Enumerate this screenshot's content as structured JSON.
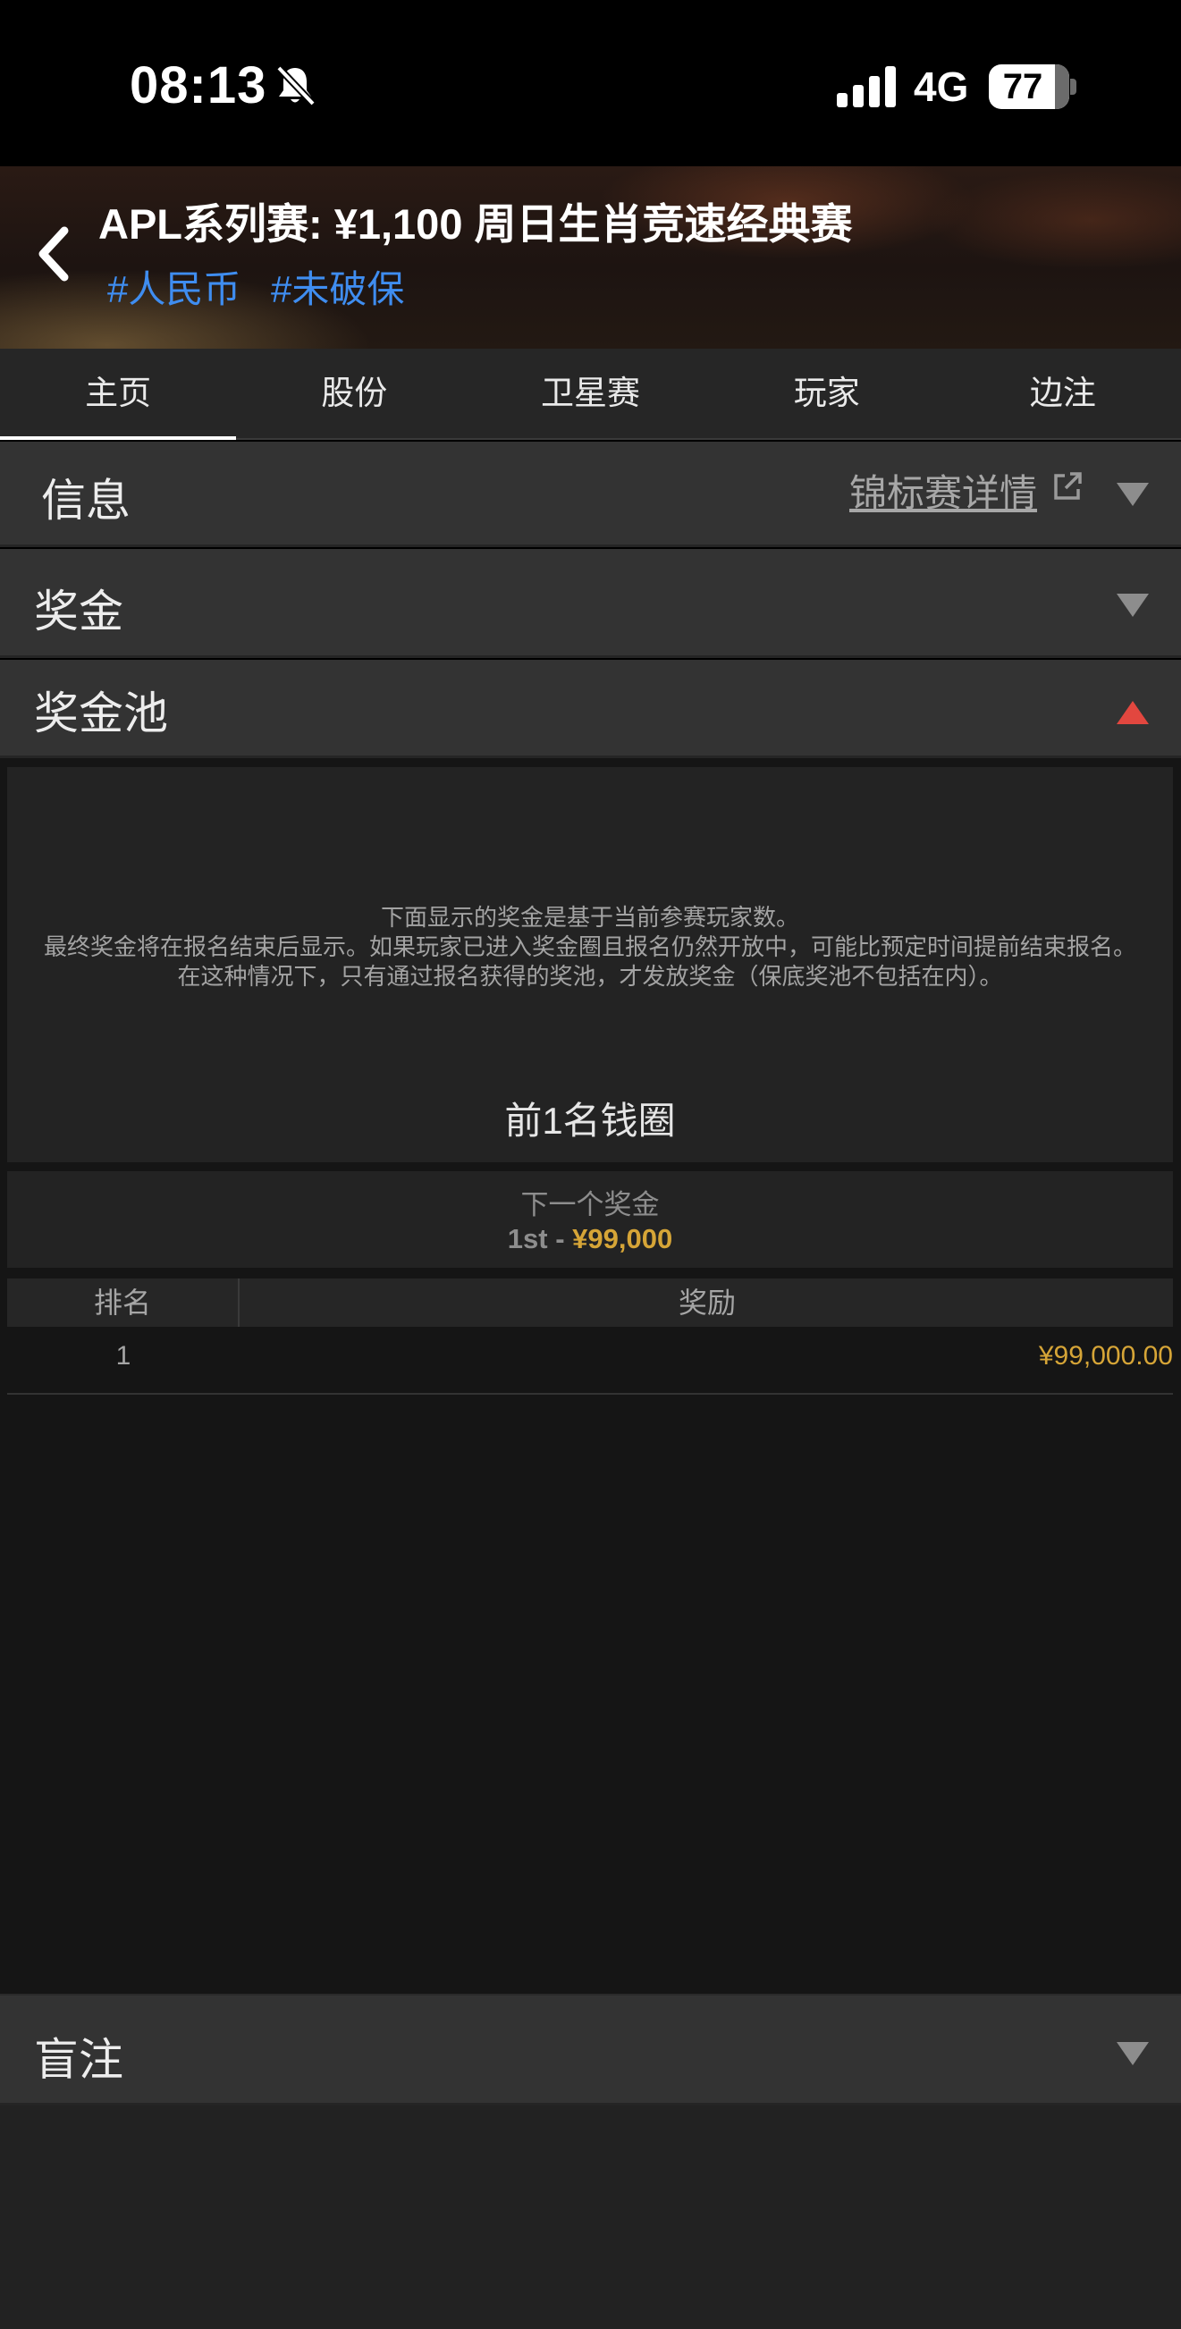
{
  "status_bar": {
    "time": "08:13",
    "network": "4G",
    "battery": "77",
    "icons": [
      "bell-slash-icon",
      "cellular-signal-icon",
      "battery-icon"
    ]
  },
  "header": {
    "title": "APL系列赛: ¥1,100 周日生肖竞速经典赛",
    "tags": [
      "#人民币",
      "#未破保"
    ],
    "back_icon": "chevron-left-icon",
    "tag_color": "#3f8df0"
  },
  "tabs": [
    {
      "label": "主页",
      "active": true
    },
    {
      "label": "股份",
      "active": false
    },
    {
      "label": "卫星赛",
      "active": false
    },
    {
      "label": "玩家",
      "active": false
    },
    {
      "label": "边注",
      "active": false
    }
  ],
  "sections": {
    "info": {
      "label": "信息",
      "link": "锦标赛详情",
      "link_icon": "external-link-icon",
      "expanded": false
    },
    "prize": {
      "label": "奖金",
      "expanded": false
    },
    "pool": {
      "label": "奖金池",
      "expanded": true
    },
    "blinds": {
      "label": "盲注",
      "expanded": false
    }
  },
  "pool": {
    "notice_lines": [
      "下面显示的奖金是基于当前参赛玩家数。",
      "最终奖金将在报名结束后显示。如果玩家已进入奖金圈且报名仍然开放中，可能比预定时间提前结束报名。",
      "在这种情况下，只有通过报名获得的奖池，才发放奖金（保底奖池不包括在内）。"
    ],
    "itm_text": "前1名钱圈",
    "next_prize_label": "下一个奖金",
    "next_prize_place": "1st - ",
    "next_prize_amount": "¥99,000",
    "table": {
      "headers": [
        "排名",
        "奖励"
      ],
      "rows": [
        {
          "rank": "1",
          "prize": "¥99,000.00"
        }
      ]
    }
  },
  "colors": {
    "accent_gold": "#d6a537",
    "expanded_caret": "#e2473f"
  }
}
